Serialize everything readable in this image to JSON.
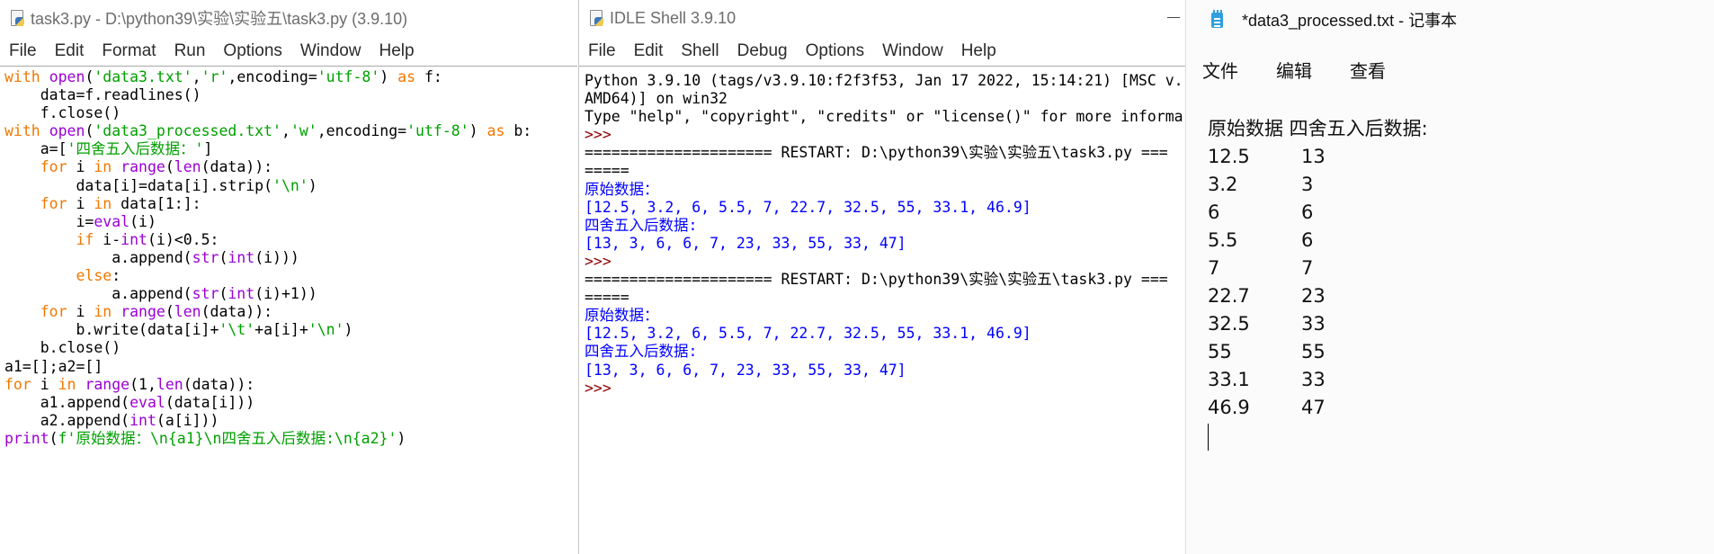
{
  "editor": {
    "title": "task3.py - D:\\python39\\实验\\实验五\\task3.py (3.9.10)",
    "menu": [
      "File",
      "Edit",
      "Format",
      "Run",
      "Options",
      "Window",
      "Help"
    ]
  },
  "shell": {
    "title": "IDLE Shell 3.9.10",
    "menu": [
      "File",
      "Edit",
      "Shell",
      "Debug",
      "Options",
      "Window",
      "Help"
    ]
  },
  "notepad": {
    "title": "*data3_processed.txt - 记事本",
    "menu": [
      "文件",
      "编辑",
      "查看"
    ],
    "header": "原始数据 四舍五入后数据:",
    "rows": [
      [
        "12.5",
        "13"
      ],
      [
        "3.2",
        "3"
      ],
      [
        "6",
        "6"
      ],
      [
        "5.5",
        "6"
      ],
      [
        "7",
        "7"
      ],
      [
        "22.7",
        "23"
      ],
      [
        "32.5",
        "33"
      ],
      [
        "55",
        "55"
      ],
      [
        "33.1",
        "33"
      ],
      [
        "46.9",
        "47"
      ]
    ]
  },
  "colors": {
    "keyword": "#f07800",
    "builtin": "#9b00d3",
    "string": "#00a000",
    "shell_output": "#0000ff",
    "shell_prompt": "#900000"
  }
}
